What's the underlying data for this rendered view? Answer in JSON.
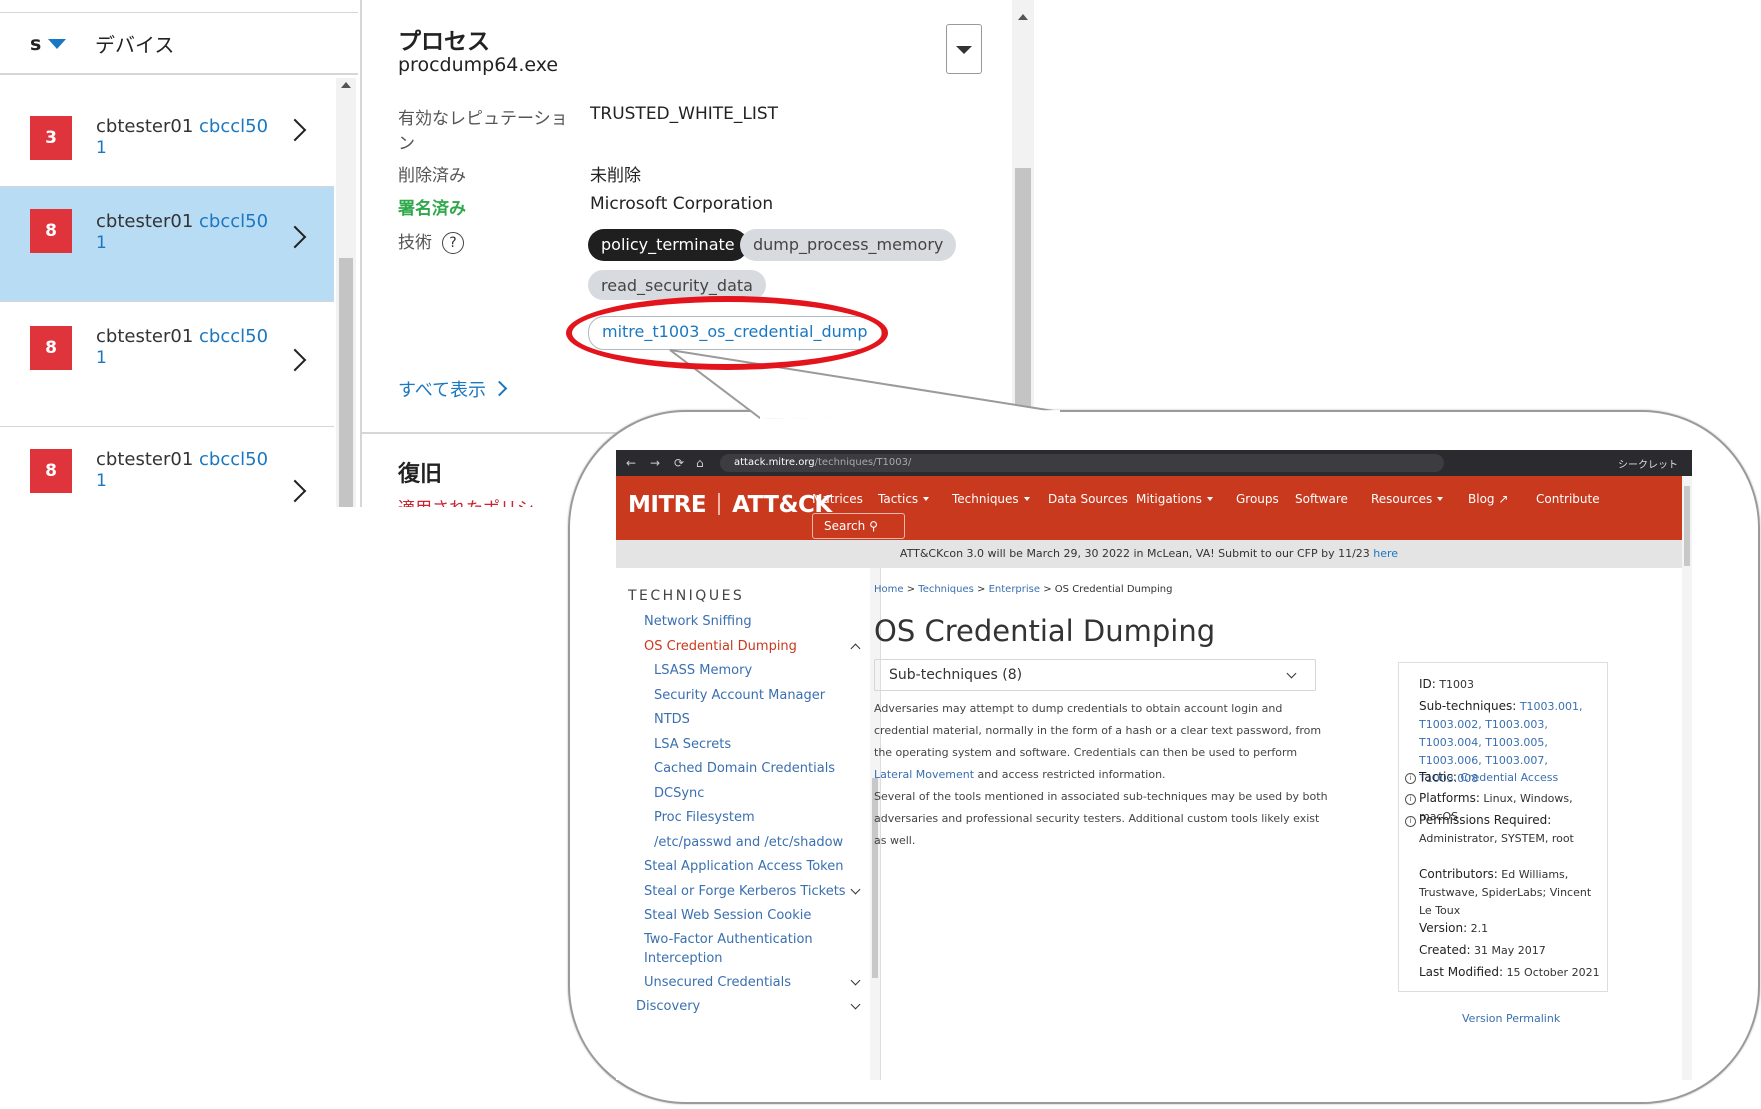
{
  "device_list": {
    "col_s": "s",
    "col_device": "デバイス",
    "rows": [
      {
        "severity": "3",
        "user": "cbtester01",
        "host": "cbccl50",
        "num": "1"
      },
      {
        "severity": "8",
        "user": "cbtester01",
        "host": "cbccl50",
        "num": "1"
      },
      {
        "severity": "8",
        "user": "cbtester01",
        "host": "cbccl50",
        "num": "1"
      },
      {
        "severity": "8",
        "user": "cbtester01",
        "host": "cbccl50",
        "num": "1"
      }
    ]
  },
  "process_panel": {
    "title": "プロセス",
    "process_name": "procdump64.exe",
    "reputation_label_1": "有効なレピュテーショ",
    "reputation_label_2": "ン",
    "reputation_value": "TRUSTED_WHITE_LIST",
    "deleted_label": "削除済み",
    "deleted_value": "未削除",
    "signed_label": "署名済み",
    "signed_value": "Microsoft Corporation",
    "technique_label": "技術",
    "help_glyph": "?",
    "tags": [
      "policy_terminate",
      "dump_process_memory",
      "read_security_data",
      "mitre_t1003_os_credential_dump"
    ],
    "show_all": "すべて表示",
    "restore_title": "復旧",
    "restore_sub": "適用されたポリシ"
  },
  "browser": {
    "url_host": "attack.mitre.org",
    "url_path": "/techniques/T1003/",
    "nav_back": "←",
    "nav_forward": "→",
    "nav_reload": "⟳",
    "nav_home": "⌂",
    "right_label": "シークレット"
  },
  "mitre": {
    "logo_left": "MITRE",
    "logo_right": "ATT&CK",
    "nav": [
      "Matrices",
      "Tactics",
      "Techniques",
      "Data Sources",
      "Mitigations",
      "Groups",
      "Software",
      "Resources",
      "Blog",
      "Contribute"
    ],
    "search": "Search",
    "banner_text": "ATT&CKcon 3.0 will be March 29, 30 2022 in McLean, VA! Submit to our CFP by 11/23 ",
    "banner_link": "here",
    "sidebar_title": "TECHNIQUES",
    "sidebar_items": [
      "Network Sniffing",
      "OS Credential Dumping",
      "LSASS Memory",
      "Security Account Manager",
      "NTDS",
      "LSA Secrets",
      "Cached Domain Credentials",
      "DCSync",
      "Proc Filesystem",
      "/etc/passwd and /etc/shadow",
      "Steal Application Access Token",
      "Steal or Forge Kerberos Tickets",
      "Steal Web Session Cookie",
      "Two-Factor Authentication",
      "Interception",
      "Unsecured Credentials",
      "Discovery"
    ],
    "breadcrumb": [
      "Home",
      "Techniques",
      "Enterprise",
      "OS Credential Dumping"
    ],
    "page_title": "OS Credential Dumping",
    "subtechniques": "Sub-techniques (8)",
    "para1_a": "Adversaries may attempt to dump credentials to obtain account login and credential material, normally in the form of a hash or a clear text password, from the operating system and software. Credentials can then be used to perform ",
    "para1_link": "Lateral Movement",
    "para1_b": " and access restricted information.",
    "para2": "Several of the tools mentioned in associated sub-techniques may be used by both adversaries and professional security testers. Additional custom tools likely exist as well.",
    "card": {
      "id_label": "ID:",
      "id_value": "T1003",
      "sub_label": "Sub-techniques:",
      "sub_values": "T1003.001, T1003.002, T1003.003, T1003.004, T1003.005, T1003.006, T1003.007, T1003.008",
      "tactic_label": "Tactic:",
      "tactic_value": "Credential Access",
      "platforms_label": "Platforms:",
      "platforms_value": "Linux, Windows, macOS",
      "perm_label": "Permissions Required:",
      "perm_value": "Administrator, SYSTEM, root",
      "contrib_label": "Contributors:",
      "contrib_value": "Ed Williams, Trustwave, SpiderLabs; Vincent Le Toux",
      "version_label": "Version:",
      "version_value": "2.1",
      "created_label": "Created:",
      "created_value": "31 May 2017",
      "modified_label": "Last Modified:",
      "modified_value": "15 October 2021"
    },
    "permalink": "Version Permalink"
  },
  "colors": {
    "mitre_red": "#c8391d",
    "badge_red": "#e0343c",
    "selected_row": "#b9dcf5",
    "link_blue": "#1a78c2",
    "highlight_ellipse": "#e3141b"
  }
}
